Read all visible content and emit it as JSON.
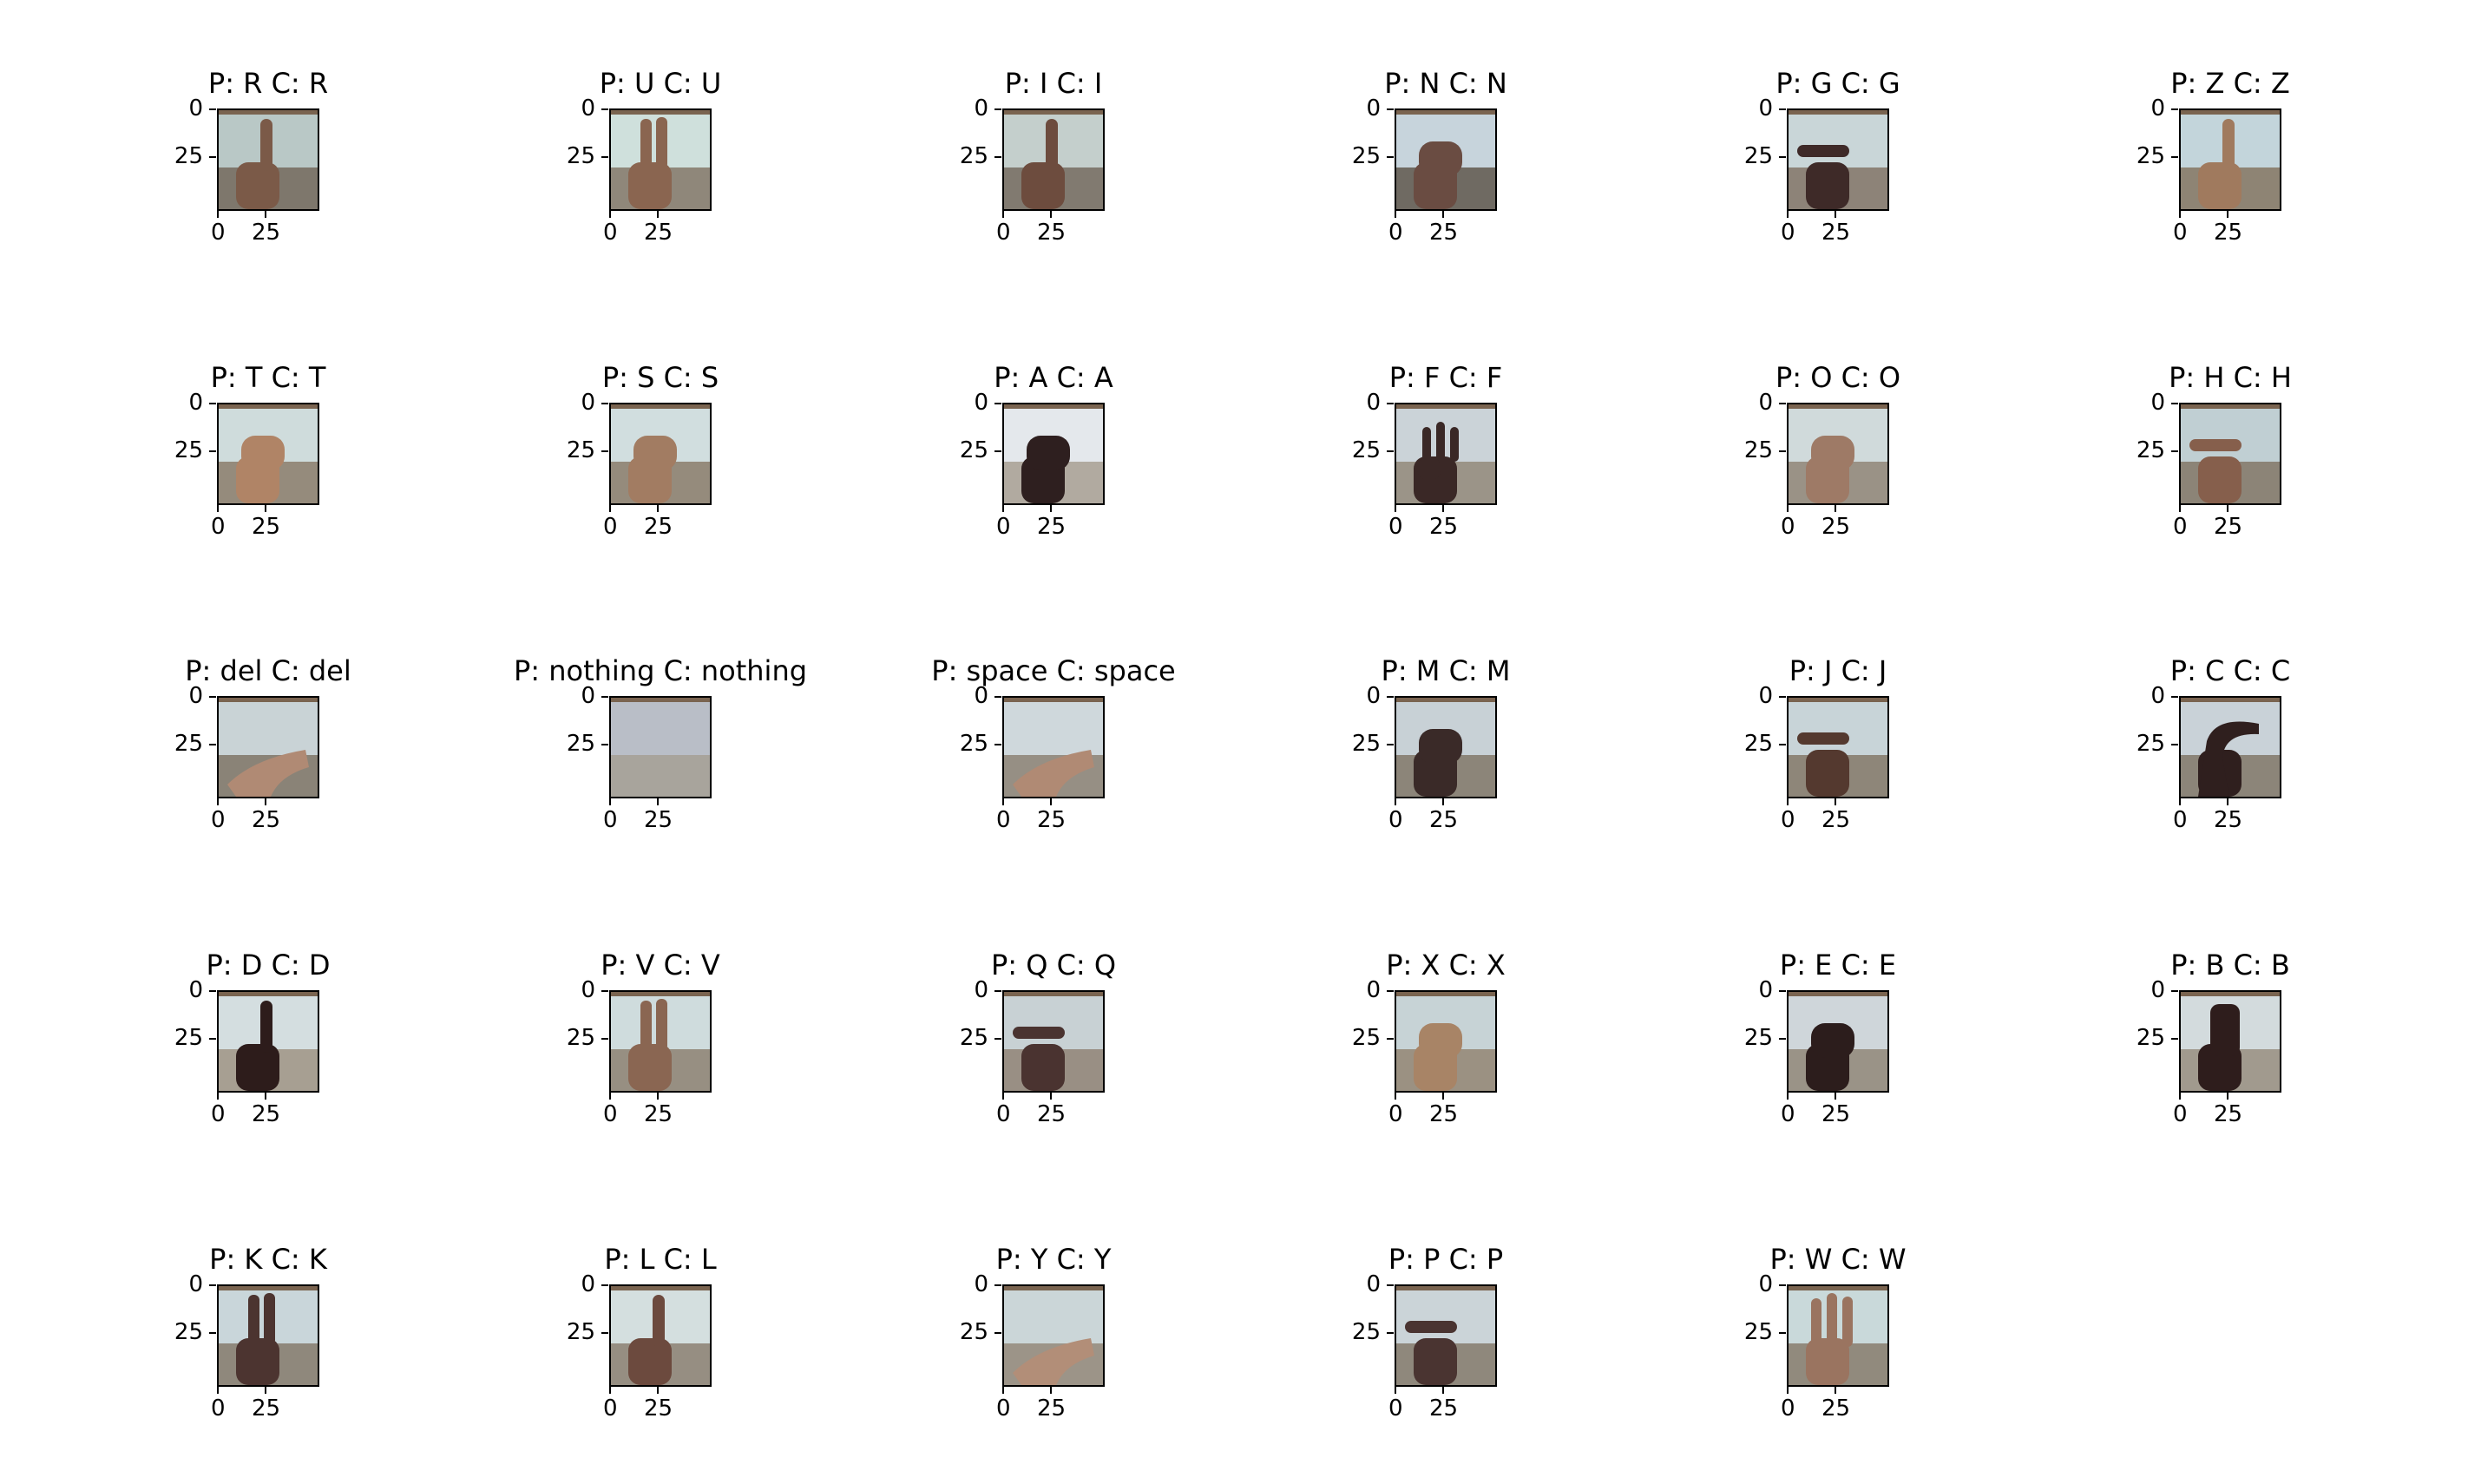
{
  "panels": [
    {
      "title": "P: R C: R",
      "hand": "#7b5a48",
      "wall": "#b9c8c6",
      "floor": "#7e776c",
      "pose": "finger"
    },
    {
      "title": "P: U C: U",
      "hand": "#8a6550",
      "wall": "#cfe0dc",
      "floor": "#8f877a",
      "pose": "two"
    },
    {
      "title": "P: I C: I",
      "hand": "#6d4c3e",
      "wall": "#c4cfcc",
      "floor": "#817a70",
      "pose": "finger"
    },
    {
      "title": "P: N C: N",
      "hand": "#6a4c42",
      "wall": "#c7d4dc",
      "floor": "#6f6a62",
      "pose": "fist"
    },
    {
      "title": "P: G C: G",
      "hand": "#3e2a28",
      "wall": "#c9d6d8",
      "floor": "#8d8378",
      "pose": "point"
    },
    {
      "title": "P: Z C: Z",
      "hand": "#a07a5e",
      "wall": "#c3d5db",
      "floor": "#8e8474",
      "pose": "finger"
    },
    {
      "title": "P: T C: T",
      "hand": "#b08466",
      "wall": "#cfdcdc",
      "floor": "#958b7c",
      "pose": "fist"
    },
    {
      "title": "P: S C: S",
      "hand": "#a27c62",
      "wall": "#d1dedf",
      "floor": "#958b7c",
      "pose": "fist"
    },
    {
      "title": "P: A C: A",
      "hand": "#2e1f1f",
      "wall": "#e4e8ec",
      "floor": "#b1aaa0",
      "pose": "fist"
    },
    {
      "title": "P: F C: F",
      "hand": "#3a2826",
      "wall": "#cbd3d8",
      "floor": "#9b9488",
      "pose": "fingers"
    },
    {
      "title": "P: O C: O",
      "hand": "#9e7a66",
      "wall": "#d0dadb",
      "floor": "#9a9286",
      "pose": "fist"
    },
    {
      "title": "P: H C: H",
      "hand": "#865f4c",
      "wall": "#c0cfd3",
      "floor": "#8c8477",
      "pose": "point"
    },
    {
      "title": "P: del C: del",
      "hand": "#b08a74",
      "wall": "#c9d3d6",
      "floor": "#8a8377",
      "pose": "flat"
    },
    {
      "title": "P: nothing C: nothing",
      "hand": "",
      "wall": "#b9bec7",
      "floor": "#a8a49c",
      "pose": "none"
    },
    {
      "title": "P: space C: space",
      "hand": "#b08a74",
      "wall": "#cfd8dc",
      "floor": "#968f84",
      "pose": "flat"
    },
    {
      "title": "P: M C: M",
      "hand": "#3a2a28",
      "wall": "#c8d1d6",
      "floor": "#8c8579",
      "pose": "fist"
    },
    {
      "title": "P: J C: J",
      "hand": "#54392f",
      "wall": "#c8d4d8",
      "floor": "#8e8679",
      "pose": "point"
    },
    {
      "title": "P: C C: C",
      "hand": "#2f1f1e",
      "wall": "#c9d2d8",
      "floor": "#8c8579",
      "pose": "curve"
    },
    {
      "title": "P: D C: D",
      "hand": "#2d1c1b",
      "wall": "#d4dee0",
      "floor": "#a79f92",
      "pose": "finger"
    },
    {
      "title": "P: V C: V",
      "hand": "#8a6652",
      "wall": "#cfdcdd",
      "floor": "#978f82",
      "pose": "two"
    },
    {
      "title": "P: Q C: Q",
      "hand": "#4a3330",
      "wall": "#c8d1d4",
      "floor": "#998f84",
      "pose": "point"
    },
    {
      "title": "P: X C: X",
      "hand": "#a88466",
      "wall": "#c7d3d6",
      "floor": "#9b9182",
      "pose": "fist"
    },
    {
      "title": "P: E C: E",
      "hand": "#2c1d1c",
      "wall": "#cfd6da",
      "floor": "#9a9387",
      "pose": "fist"
    },
    {
      "title": "P: B C: B",
      "hand": "#2e1d1c",
      "wall": "#d3dbdd",
      "floor": "#a19a8e",
      "pose": "flat-up"
    },
    {
      "title": "P: K C: K",
      "hand": "#4c3430",
      "wall": "#c9d6da",
      "floor": "#8f887c",
      "pose": "two"
    },
    {
      "title": "P: L C: L",
      "hand": "#6c4a3e",
      "wall": "#d4dfdf",
      "floor": "#968e82",
      "pose": "finger"
    },
    {
      "title": "P: Y C: Y",
      "hand": "#b28e78",
      "wall": "#cbd6d8",
      "floor": "#9c9488",
      "pose": "flat"
    },
    {
      "title": "P: P C: P",
      "hand": "#4a3431",
      "wall": "#cbd4d8",
      "floor": "#8f887c",
      "pose": "point"
    },
    {
      "title": "P: W C: W",
      "hand": "#9a7460",
      "wall": "#c9d9da",
      "floor": "#918a7d",
      "pose": "three"
    }
  ],
  "ticks": {
    "y": [
      "0",
      "25"
    ],
    "x": [
      "0",
      "25"
    ]
  }
}
